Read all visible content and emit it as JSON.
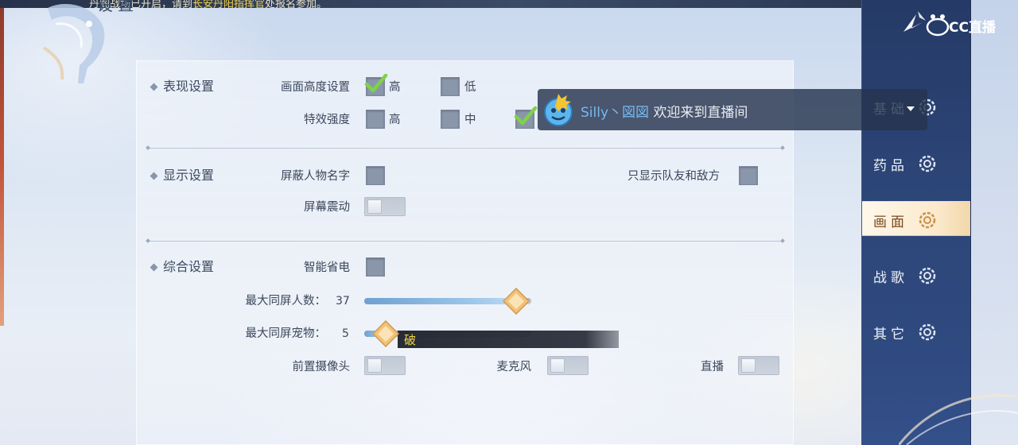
{
  "announcement": {
    "prefix": "丹阁战场已开启，请到",
    "highlight": "长安丹阳指挥官",
    "suffix": "处报名参加。"
  },
  "window": {
    "title": "设置"
  },
  "sections": {
    "performance": {
      "title": "表现设置",
      "row1": {
        "label": "画面高度设置",
        "opt_high": "高",
        "opt_low": "低",
        "selected": "高"
      },
      "row2": {
        "label": "特效强度",
        "opt_high": "高",
        "opt_mid": "中"
      }
    },
    "display": {
      "title": "显示设置",
      "hide_names": {
        "label": "屏蔽人物名字",
        "checked": false
      },
      "only_team": {
        "label": "只显示队友和敌方",
        "checked": false
      },
      "shake": {
        "label": "屏幕震动",
        "on": false
      }
    },
    "general": {
      "title": "综合设置",
      "power_save": {
        "label": "智能省电",
        "checked": false
      },
      "max_players": {
        "label": "最大同屏人数：",
        "value": "37",
        "fraction": 0.91
      },
      "max_pets": {
        "label": "最大同屏宠物：",
        "value": "5",
        "fraction": 0.13
      },
      "front_camera": {
        "label": "前置摄像头",
        "on": false
      },
      "microphone": {
        "label": "麦克风",
        "on": false
      },
      "live": {
        "label": "直播",
        "on": false
      }
    }
  },
  "overlay_bar": {
    "text": "破"
  },
  "chat": {
    "user": "Silly丶図図",
    "message": "欢迎来到直播间"
  },
  "stream_logo": {
    "text": "CC直播"
  },
  "sidebar": {
    "items": [
      {
        "label": "基础",
        "active": false
      },
      {
        "label": "药品",
        "active": false
      },
      {
        "label": "画面",
        "active": true
      },
      {
        "label": "战歌",
        "active": false
      },
      {
        "label": "其它",
        "active": false
      }
    ]
  },
  "colors": {
    "accent": "#f3d24a",
    "sidebar": "#2d4679",
    "active_tab": "#fbe9cc",
    "checkbox": "#8a96aa",
    "slider_fill": "#6fa0cf"
  }
}
